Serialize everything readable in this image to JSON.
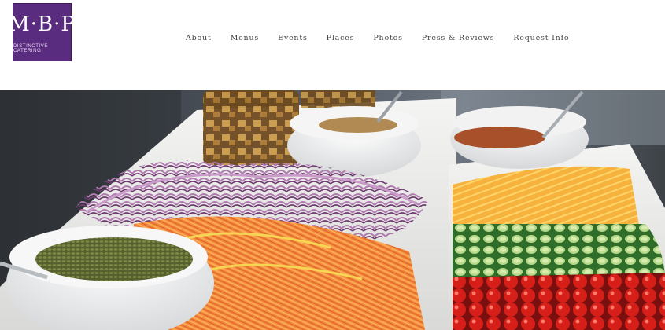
{
  "brand": {
    "logo_text": "M·B·P",
    "tagline": "DISTINCTIVE CATERING",
    "color": "#5a2c7f"
  },
  "nav": {
    "items": [
      {
        "label": "About"
      },
      {
        "label": "Menus"
      },
      {
        "label": "Events"
      },
      {
        "label": "Places"
      },
      {
        "label": "Photos"
      },
      {
        "label": "Press & Reviews"
      },
      {
        "label": "Request Info"
      }
    ]
  },
  "hero": {
    "subject": "salad-bar-toppings-photo"
  }
}
